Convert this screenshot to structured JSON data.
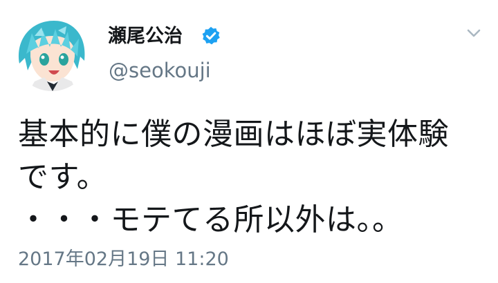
{
  "tweet": {
    "author": {
      "display_name": "瀬尾公治",
      "handle": "@seokouji",
      "verified": true,
      "avatar": "anime-boy-avatar"
    },
    "text": "基本的に僕の漫画はほぼ実体験\nです。\n・・・モテてる所以外は。。",
    "timestamp": "2017年02月19日 11:20",
    "menu_icon": "chevron-down-icon"
  },
  "colors": {
    "text": "#14171a",
    "secondary_text": "#657786",
    "verified_blue": "#1da1f2",
    "background": "#ffffff"
  }
}
